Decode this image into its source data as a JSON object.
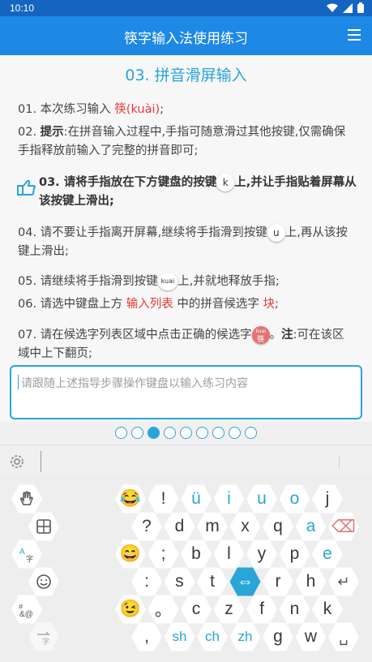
{
  "status": {
    "time": "10:10"
  },
  "appbar": {
    "title": "筷字输入法使用练习"
  },
  "content": {
    "heading": "03. 拼音滑屏输入",
    "s1a": "01. 本次练习输入 ",
    "s1b": "筷(kuài)",
    "s1c": ";",
    "s2a": "02. ",
    "s2b": "提示",
    "s2c": ":在拼音输入过程中,手指可随意滑过其他按键,仅需确保手指释放前输入了完整的拼音即可;",
    "s3a": "03. 请将手指放在下方键盘的按键",
    "s3k": "k",
    "s3b": "上,并让手指贴着屏幕从该按键上滑出;",
    "s4a": "04. 请不要让手指离开屏幕,继续将手指滑到按键",
    "s4k": "u",
    "s4b": "上,再从该按键上滑出;",
    "s5a": "05. 请继续将手指滑到按键",
    "s5k": "kuai",
    "s5b": "上,并就地释放手指;",
    "s6a": "06. 请选中键盘上方 ",
    "s6b": "输入列表",
    "s6c": " 中的拼音候选字 ",
    "s6d": "块",
    "s6e": ";",
    "s7a": "07. 请在候选字列表区域中点击正确的候选字",
    "s7k1": "kuai",
    "s7k2": "筷",
    "s7b": "。",
    "s7c": "注",
    "s7d": ":可在该区域中上下翻页;",
    "placeholder": "请跟随上述指导步骤操作键盘以输入练习内容"
  },
  "pager": {
    "count": 9,
    "active": 2
  },
  "keyboard": {
    "left_keys": [
      {
        "name": "hand-gesture-key",
        "icon": "hand-icon"
      },
      {
        "name": "calculator-key",
        "icon": "grid-icon"
      },
      {
        "name": "translate-key",
        "icon": "translate-icon"
      },
      {
        "name": "emoji-key",
        "icon": "smile-icon"
      },
      {
        "name": "symbols-key",
        "icon": "symbols-icon"
      },
      {
        "name": "switch-key",
        "icon": "switch-icon"
      }
    ],
    "rows": [
      [
        "😂",
        "!",
        "ü",
        "i",
        "u",
        "o",
        "j"
      ],
      [
        "?",
        "d",
        "m",
        "x",
        "q",
        "a",
        "⌫"
      ],
      [
        "😄",
        ";",
        "b",
        "l",
        "y",
        "p",
        "e"
      ],
      [
        ":",
        "s",
        "t",
        "⇔",
        "r",
        "h",
        "↵"
      ],
      [
        "😉",
        "。",
        "c",
        "z",
        "f",
        "n",
        "k"
      ],
      [
        ",",
        "sh",
        "ch",
        "zh",
        "g",
        "w",
        "␣"
      ]
    ],
    "blue_keys": [
      "ü",
      "i",
      "u",
      "o",
      "a",
      "e",
      "sh",
      "ch",
      "zh"
    ],
    "colors": {
      "accent": "#29a5d8",
      "appbar": "#1e88e5",
      "highlight": "#e53935"
    }
  }
}
